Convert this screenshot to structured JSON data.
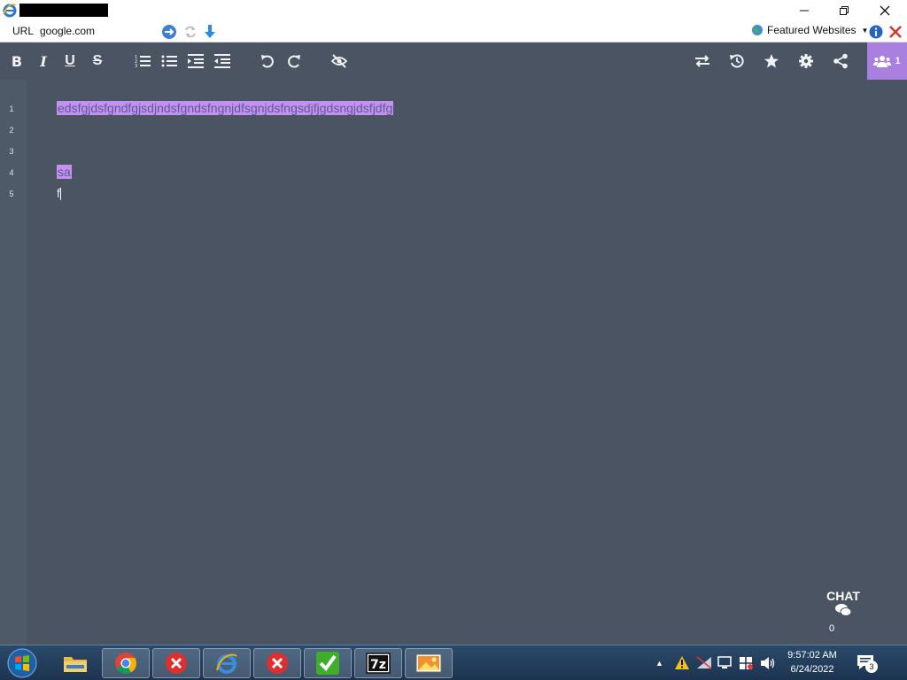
{
  "browser": {
    "url_label": "URL",
    "url_value": "google.com",
    "featured_label": "Featured Websites"
  },
  "editor": {
    "line_numbers": [
      "1",
      "2",
      "3",
      "4",
      "5"
    ],
    "lines": [
      "edsfgjdsfgndfgjsdjndsfgndsfngnjdfsgnjdsfngsdjfjgdsngjdsfjdfg",
      "",
      "",
      "sa",
      "f"
    ]
  },
  "users": {
    "count": "1"
  },
  "chat": {
    "label": "CHAT",
    "count": "0"
  },
  "taskbar": {
    "time": "9:57:02 AM",
    "date": "6/24/2022",
    "notification_count": "3"
  },
  "colors": {
    "editor_bg": "#4a5463",
    "highlight": "#c492ee",
    "users_button": "#a97fe0"
  }
}
